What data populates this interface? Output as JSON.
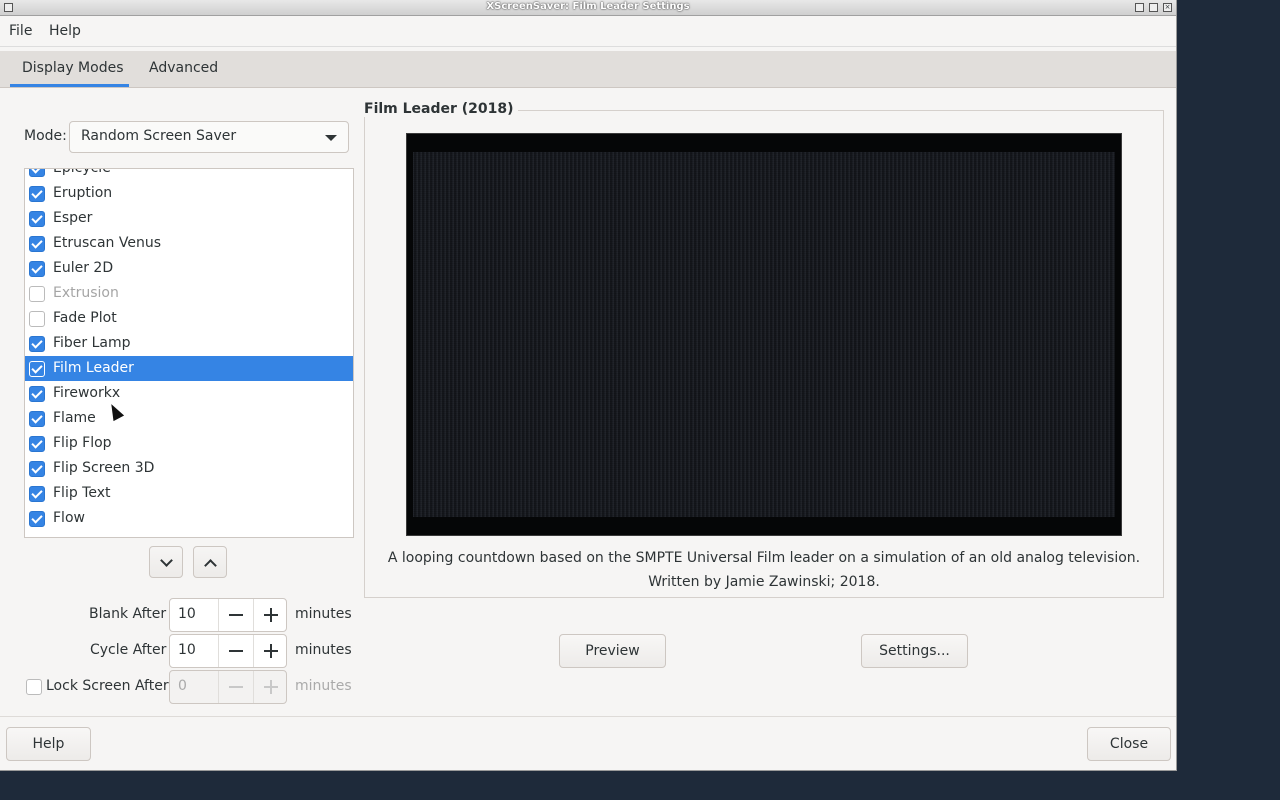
{
  "window": {
    "title": "XScreenSaver: Film Leader Settings"
  },
  "menu": {
    "file": "File",
    "help": "Help"
  },
  "tabs": [
    {
      "label": "Display Modes",
      "active": true
    },
    {
      "label": "Advanced",
      "active": false
    }
  ],
  "mode": {
    "label": "Mode:",
    "value": "Random Screen Saver"
  },
  "list": {
    "items": [
      {
        "label": "Epicycle",
        "checked": true
      },
      {
        "label": "Eruption",
        "checked": true
      },
      {
        "label": "Esper",
        "checked": true
      },
      {
        "label": "Etruscan Venus",
        "checked": true
      },
      {
        "label": "Euler 2D",
        "checked": true
      },
      {
        "label": "Extrusion",
        "checked": false,
        "disabled": true
      },
      {
        "label": "Fade Plot",
        "checked": false
      },
      {
        "label": "Fiber Lamp",
        "checked": true
      },
      {
        "label": "Film Leader",
        "checked": true,
        "selected": true
      },
      {
        "label": "Fireworkx",
        "checked": true
      },
      {
        "label": "Flame",
        "checked": true
      },
      {
        "label": "Flip Flop",
        "checked": true
      },
      {
        "label": "Flip Screen 3D",
        "checked": true
      },
      {
        "label": "Flip Text",
        "checked": true
      },
      {
        "label": "Flow",
        "checked": true
      }
    ]
  },
  "timing": {
    "blank_label": "Blank After",
    "blank_value": "10",
    "cycle_label": "Cycle After",
    "cycle_value": "10",
    "lock_label": "Lock Screen After",
    "lock_value": "0",
    "unit": "minutes"
  },
  "preview": {
    "title": "Film Leader (2018)",
    "desc_line1": "A looping countdown based on the SMPTE Universal Film leader on a simulation of an old analog television.",
    "desc_line2": "Written by Jamie Zawinski; 2018."
  },
  "buttons": {
    "preview": "Preview",
    "settings": "Settings...",
    "help": "Help",
    "close": "Close"
  },
  "colors": {
    "accent": "#3584e4",
    "desktop": "#1e2a3a"
  }
}
